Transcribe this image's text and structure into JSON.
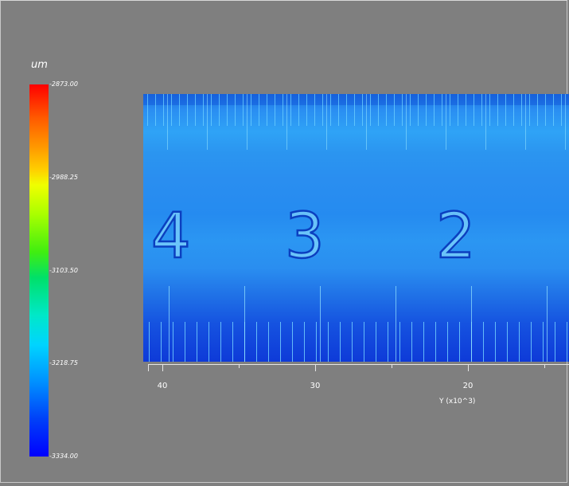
{
  "colorbar": {
    "unit": "um",
    "labels": [
      "-2873.00",
      "-2988.25",
      "-3103.50",
      "-3218.75",
      "-3334.00"
    ],
    "colors": [
      "#ff0000",
      "#ffff00",
      "#00ff00",
      "#00ffff",
      "#0000ff"
    ]
  },
  "surface": {
    "numerals": [
      "4",
      "3",
      "2"
    ],
    "base_color": "#2a8ef0"
  },
  "axis": {
    "title": "Y (x10^3)",
    "tick_labels": [
      "40",
      "30",
      "20"
    ]
  }
}
